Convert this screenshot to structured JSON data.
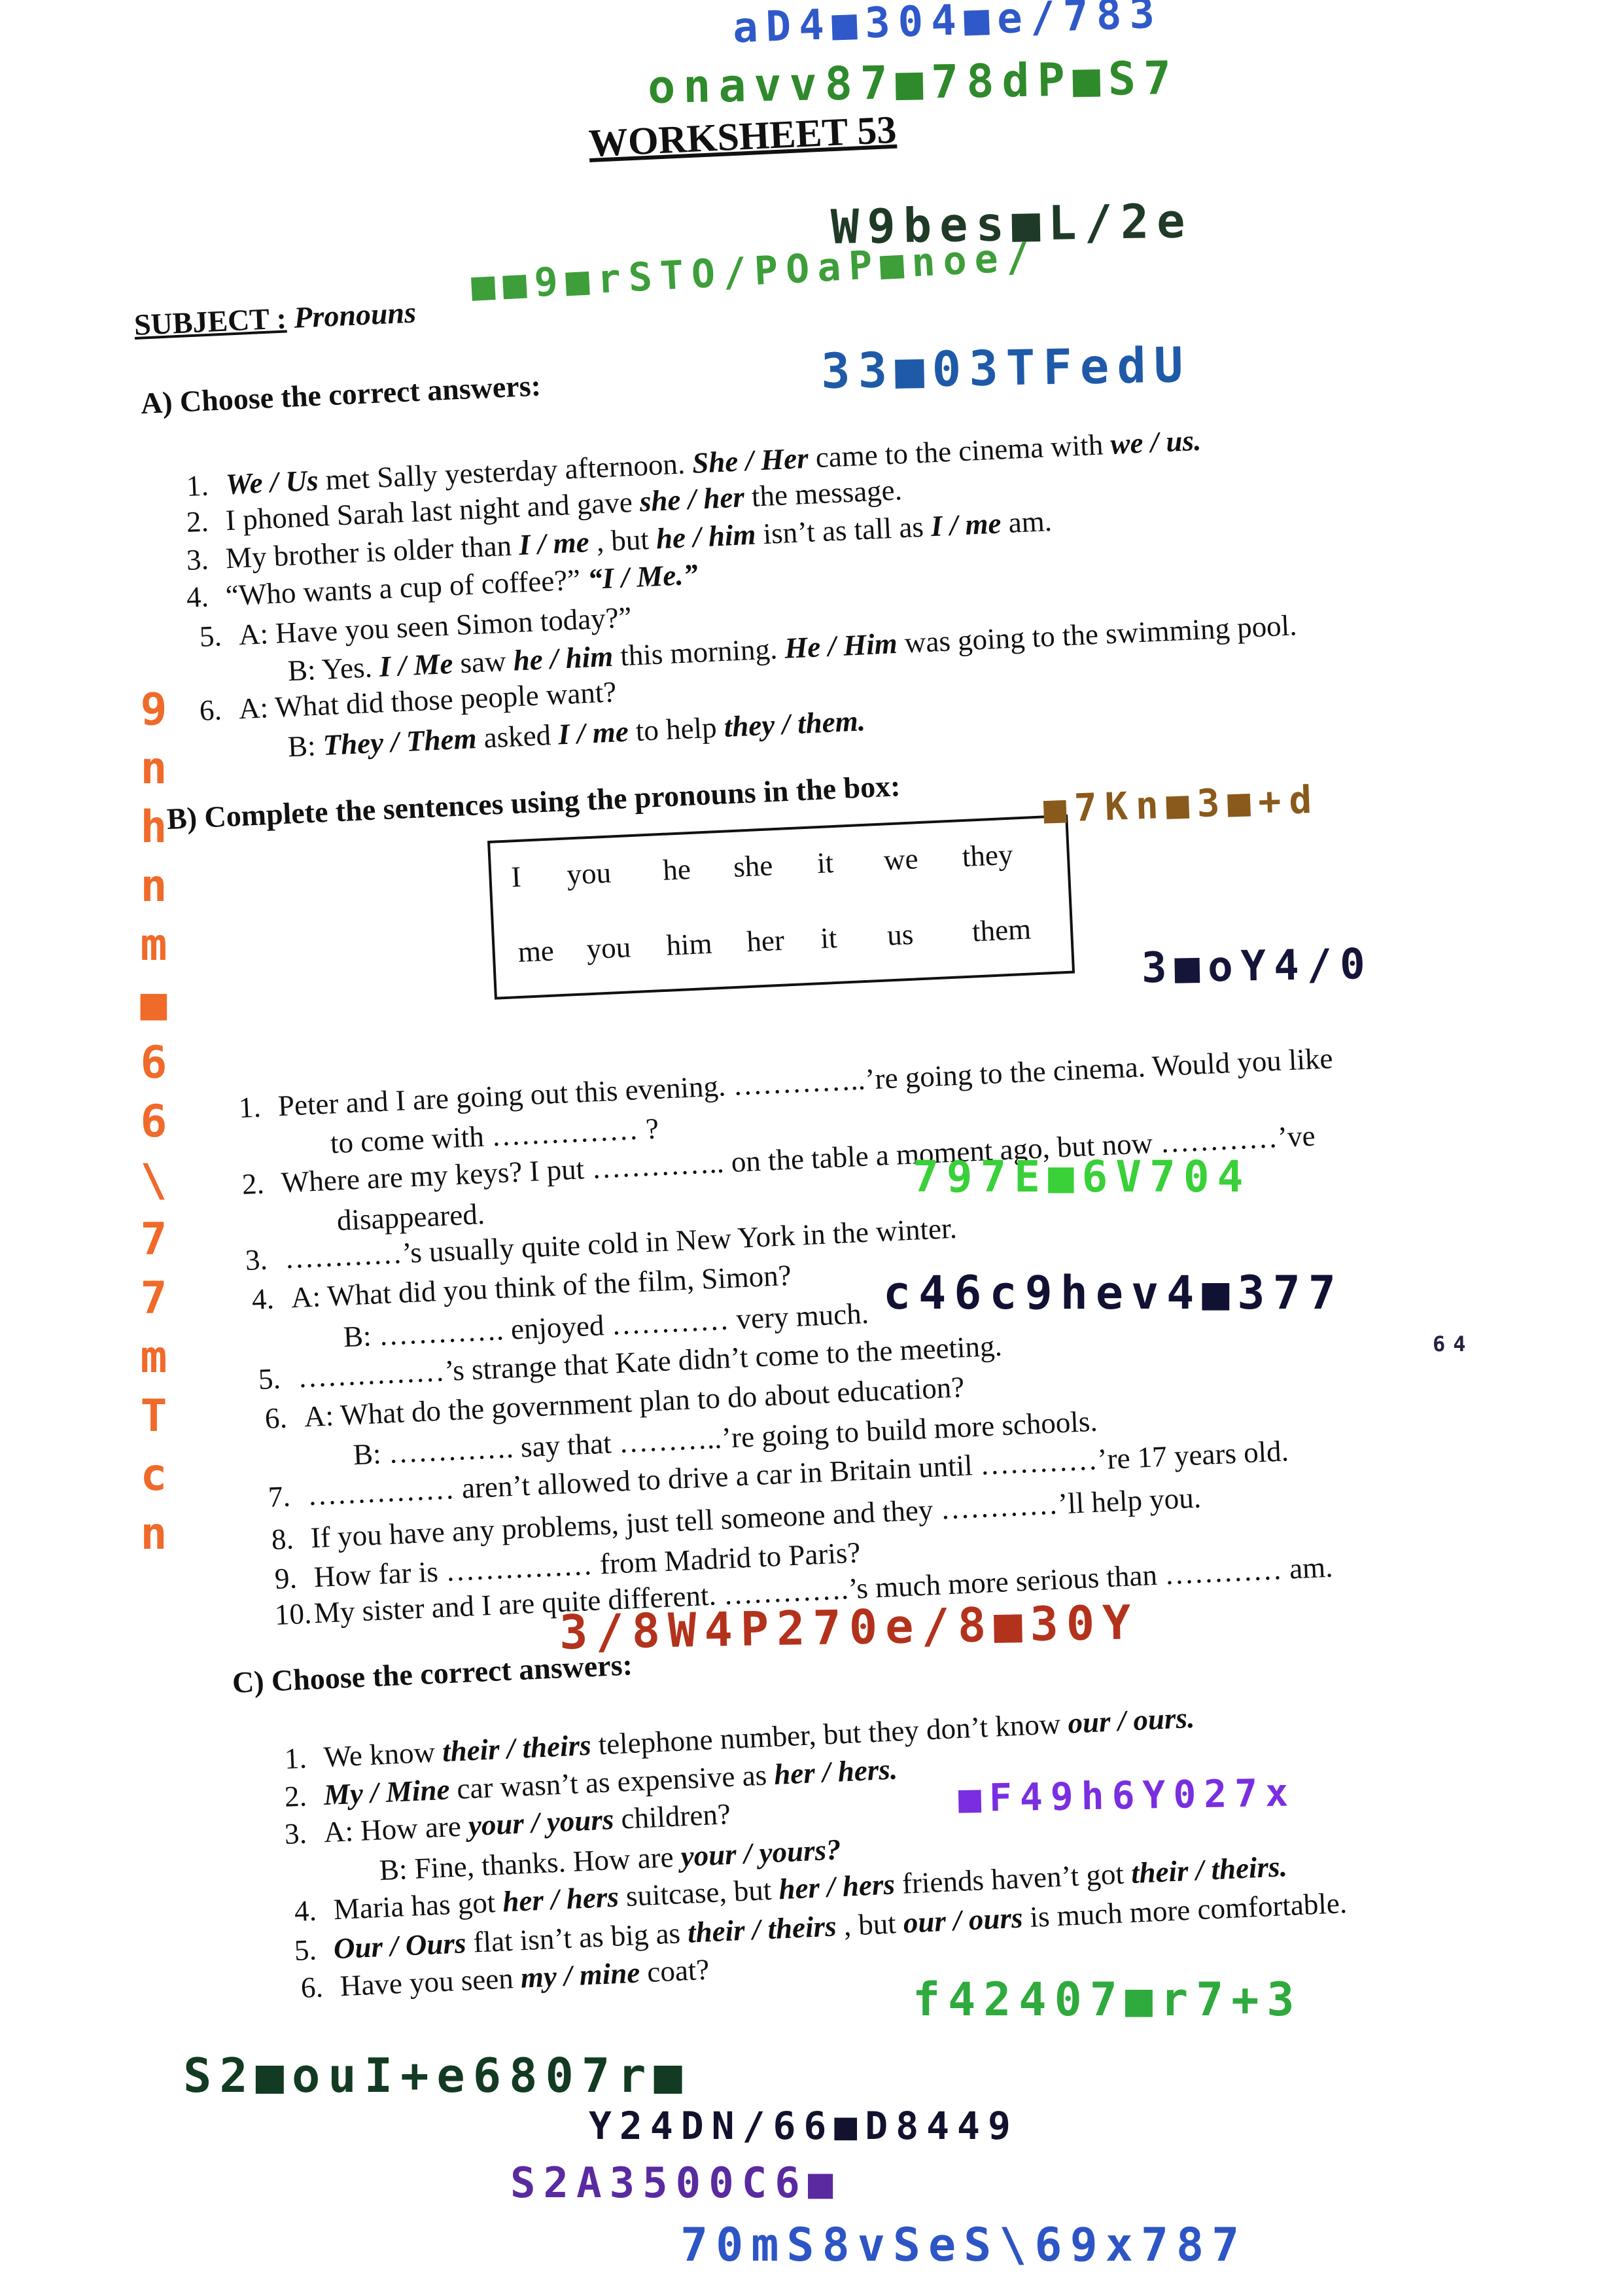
{
  "worksheet": {
    "title": "WORKSHEET 53",
    "subject_label": "SUBJECT :",
    "subject_value": "Pronouns"
  },
  "section_a": {
    "heading": "A) Choose the correct answers:",
    "items": [
      {
        "n": "1.",
        "line": [
          [
            "bi",
            "We / Us"
          ],
          [
            "",
            "met Sally yesterday afternoon. "
          ],
          [
            "bi",
            "She / Her"
          ],
          [
            "",
            "came to the cinema with "
          ],
          [
            "bi",
            "we / us."
          ]
        ]
      },
      {
        "n": "2.",
        "line": [
          [
            "",
            "I phoned Sarah last night and gave "
          ],
          [
            "bi",
            "she / her"
          ],
          [
            "",
            "the message."
          ]
        ]
      },
      {
        "n": "3.",
        "line": [
          [
            "",
            "My brother is older than "
          ],
          [
            "bi",
            "I / me"
          ],
          [
            "",
            ", but "
          ],
          [
            "bi",
            "he / him"
          ],
          [
            "",
            "isn’t as tall as "
          ],
          [
            "bi",
            "I / me"
          ],
          [
            "",
            "am."
          ]
        ]
      },
      {
        "n": "4.",
        "line": [
          [
            "",
            "“Who wants a cup of coffee?”     "
          ],
          [
            "bi",
            "“I / Me.”"
          ]
        ]
      },
      {
        "n": "5.",
        "line": [
          [
            "",
            "A: Have you seen Simon today?”"
          ]
        ]
      },
      {
        "n": "",
        "line": [
          [
            "",
            "B: Yes. "
          ],
          [
            "bi",
            "I / Me"
          ],
          [
            "",
            "saw "
          ],
          [
            "bi",
            "he / him"
          ],
          [
            "",
            "this morning. "
          ],
          [
            "bi",
            "He / Him"
          ],
          [
            "",
            "was going to the swimming pool."
          ]
        ]
      },
      {
        "n": "6.",
        "line": [
          [
            "",
            "A: What did those people want?"
          ]
        ]
      },
      {
        "n": "",
        "line": [
          [
            "",
            "B: "
          ],
          [
            "bi",
            "They / Them"
          ],
          [
            "",
            "asked "
          ],
          [
            "bi",
            "I / me"
          ],
          [
            "",
            "to help "
          ],
          [
            "bi",
            "they / them."
          ]
        ]
      }
    ]
  },
  "section_b": {
    "heading": "B) Complete the sentences using the pronouns in the box:",
    "box_row1": [
      "I",
      "you",
      "he",
      "she",
      "it",
      "we",
      "they"
    ],
    "box_row2": [
      "me",
      "you",
      "him",
      "her",
      "it",
      "us",
      "them"
    ],
    "lines": [
      {
        "n": "1.",
        "t": "Peter and I are going out this evening. …………..’re going to the cinema. Would you like"
      },
      {
        "n": "",
        "t": "to come with …………… ?"
      },
      {
        "n": "2.",
        "t": "Where are my keys? I put ………….. on the table a moment ago, but now …………’ve"
      },
      {
        "n": "",
        "t": "disappeared."
      },
      {
        "n": "3.",
        "t": "…………’s usually quite cold in New York in the winter."
      },
      {
        "n": "4.",
        "t": "A: What did you think of the film, Simon?"
      },
      {
        "n": "",
        "t": "B: …………. enjoyed ………… very much."
      },
      {
        "n": "5.",
        "t": "……………’s strange that Kate didn’t come to the meeting."
      },
      {
        "n": "6.",
        "t": "A: What do the government plan to do about education?"
      },
      {
        "n": "",
        "t": "B: …………. say that ………..’re going to build more schools."
      },
      {
        "n": "7.",
        "t": "…………… aren’t allowed to drive a car in Britain until …………’re 17 years old."
      },
      {
        "n": "8.",
        "t": "If you have any problems, just tell someone and they …………’ll help you."
      },
      {
        "n": "9.",
        "t": "How far is …………… from Madrid to Paris?"
      },
      {
        "n": "10.",
        "t": "My sister and I are quite different. ………….’s much more serious than ………… am."
      }
    ]
  },
  "section_c": {
    "heading": "C) Choose the correct answers:",
    "items": [
      {
        "n": "1.",
        "line": [
          [
            "",
            "We know "
          ],
          [
            "bi",
            "their / theirs"
          ],
          [
            "",
            "telephone number, but they don’t know "
          ],
          [
            "bi",
            "our / ours."
          ]
        ]
      },
      {
        "n": "2.",
        "line": [
          [
            "bi",
            "My / Mine"
          ],
          [
            "",
            "car wasn’t as expensive as "
          ],
          [
            "bi",
            "her / hers."
          ]
        ]
      },
      {
        "n": "3.",
        "line": [
          [
            "",
            "A: How are "
          ],
          [
            "bi",
            "your / yours"
          ],
          [
            "",
            "children?"
          ]
        ]
      },
      {
        "n": "",
        "line": [
          [
            "",
            "B: Fine, thanks. How are "
          ],
          [
            "bi",
            "your / yours?"
          ]
        ]
      },
      {
        "n": "4.",
        "line": [
          [
            "",
            "Maria has got "
          ],
          [
            "bi",
            "her / hers"
          ],
          [
            "",
            "suitcase, but "
          ],
          [
            "bi",
            "her / hers"
          ],
          [
            "",
            "friends haven’t got "
          ],
          [
            "bi",
            "their / theirs."
          ]
        ]
      },
      {
        "n": "5.",
        "line": [
          [
            "bi",
            "Our / Ours"
          ],
          [
            "",
            "flat isn’t as big as "
          ],
          [
            "bi",
            "their / theirs"
          ],
          [
            "",
            ", but "
          ],
          [
            "bi",
            "our / ours"
          ],
          [
            "",
            "is much more comfortable."
          ]
        ]
      },
      {
        "n": "6.",
        "line": [
          [
            "",
            "Have you seen "
          ],
          [
            "bi",
            "my / mine"
          ],
          [
            "",
            "coat?"
          ]
        ]
      }
    ]
  },
  "scribbles": [
    {
      "t": "aD4■304■e/783",
      "color": "#2f59c8"
    },
    {
      "t": "onavv87■78dP■S7",
      "color": "#2f8a2c"
    },
    {
      "t": "W9bes■L/2e",
      "color": "#1f3a26"
    },
    {
      "t": "■■9■rSTO/POaP■noe/",
      "color": "#3d9e3a"
    },
    {
      "t": "33■03TFedU",
      "color": "#1f5aa8"
    },
    {
      "t": "■7Kn■3■+d",
      "color": "#8a5a1c"
    },
    {
      "t": "3■oY4/0",
      "color": "#15153a"
    },
    {
      "t": "797E■6V704",
      "color": "#39d039"
    },
    {
      "t": "c46c9hev4■377",
      "color": "#111133"
    },
    {
      "t": "64",
      "color": "#222244"
    },
    {
      "t": "3/8W4P270e/8■30Y",
      "color": "#b3321c"
    },
    {
      "t": "■F49h6Y027x",
      "color": "#7a2ee0"
    },
    {
      "t": "f42407■r7+3",
      "color": "#2faa3c"
    },
    {
      "t": "S2■ouI+e6807r■",
      "color": "#133a22"
    },
    {
      "t": "Y24DN/66■D8449",
      "color": "#12122e"
    },
    {
      "t": "S2A3500C6■",
      "color": "#5a2aa0"
    },
    {
      "t": "70mS8vSeS\\69x787",
      "color": "#2d55c5"
    },
    {
      "t": "9nhnm■66\\77mTcn",
      "color": "#f06a2a"
    }
  ]
}
